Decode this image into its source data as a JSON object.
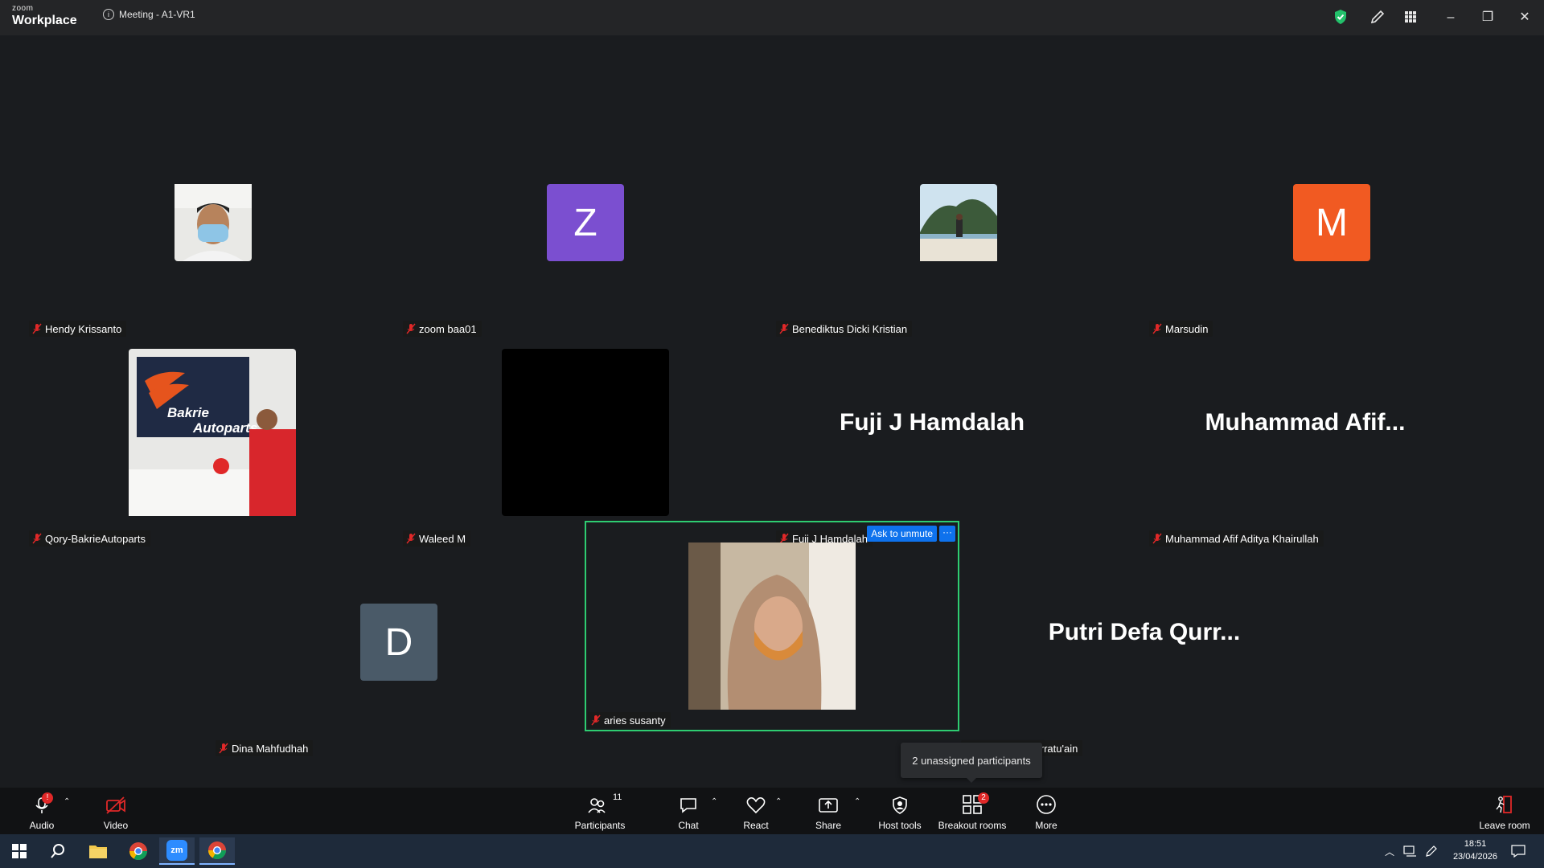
{
  "titlebar": {
    "logo_small": "zoom",
    "logo_big": "Workplace",
    "meeting_title": "Meeting - A1-VR1"
  },
  "colors": {
    "active_border": "#2ecc71",
    "accent_blue": "#0e72ed",
    "mute_red": "#e02828",
    "avatar_z": "#7b4fd0",
    "avatar_m": "#f15a22",
    "avatar_d": "#4a5a68"
  },
  "participants": [
    {
      "name": "Hendy Krissanto",
      "display": "photo-mask"
    },
    {
      "name": "zoom baa01",
      "display": "initial",
      "initial": "Z"
    },
    {
      "name": "Benediktus Dicki Kristian",
      "display": "photo-beach"
    },
    {
      "name": "Marsudin",
      "display": "initial",
      "initial": "M"
    },
    {
      "name": "Qory-BakrieAutoparts",
      "display": "photo-store",
      "store_text_1": "Bakrie",
      "store_text_2": "Autoparts"
    },
    {
      "name": "Waleed M",
      "display": "black-video"
    },
    {
      "name": "Fuji J Hamdalah",
      "display": "name",
      "big": "Fuji J Hamdalah"
    },
    {
      "name": "Muhammad Afif Aditya Khairullah",
      "display": "name",
      "big": "Muhammad  Afif..."
    },
    {
      "name": "Dina Mahfudhah",
      "display": "initial",
      "initial": "D"
    },
    {
      "name": "aries susanty",
      "display": "photo-hijab",
      "active": true,
      "ask_label": "Ask to unmute",
      "more_label": "···"
    },
    {
      "name": "Putri Defa Qurratu'ain",
      "display": "name",
      "big": "Putri  Defa  Qurr..."
    }
  ],
  "tooltip": "2 unassigned participants",
  "toolbar": {
    "audio": "Audio",
    "video": "Video",
    "participants": "Participants",
    "participants_count": "11",
    "chat": "Chat",
    "react": "React",
    "share": "Share",
    "host_tools": "Host tools",
    "breakout_rooms": "Breakout rooms",
    "breakout_badge": "2",
    "more": "More",
    "leave": "Leave room"
  },
  "taskbar": {
    "time": "18:51",
    "date": "23/04/2026",
    "zoom_label": "zm"
  }
}
